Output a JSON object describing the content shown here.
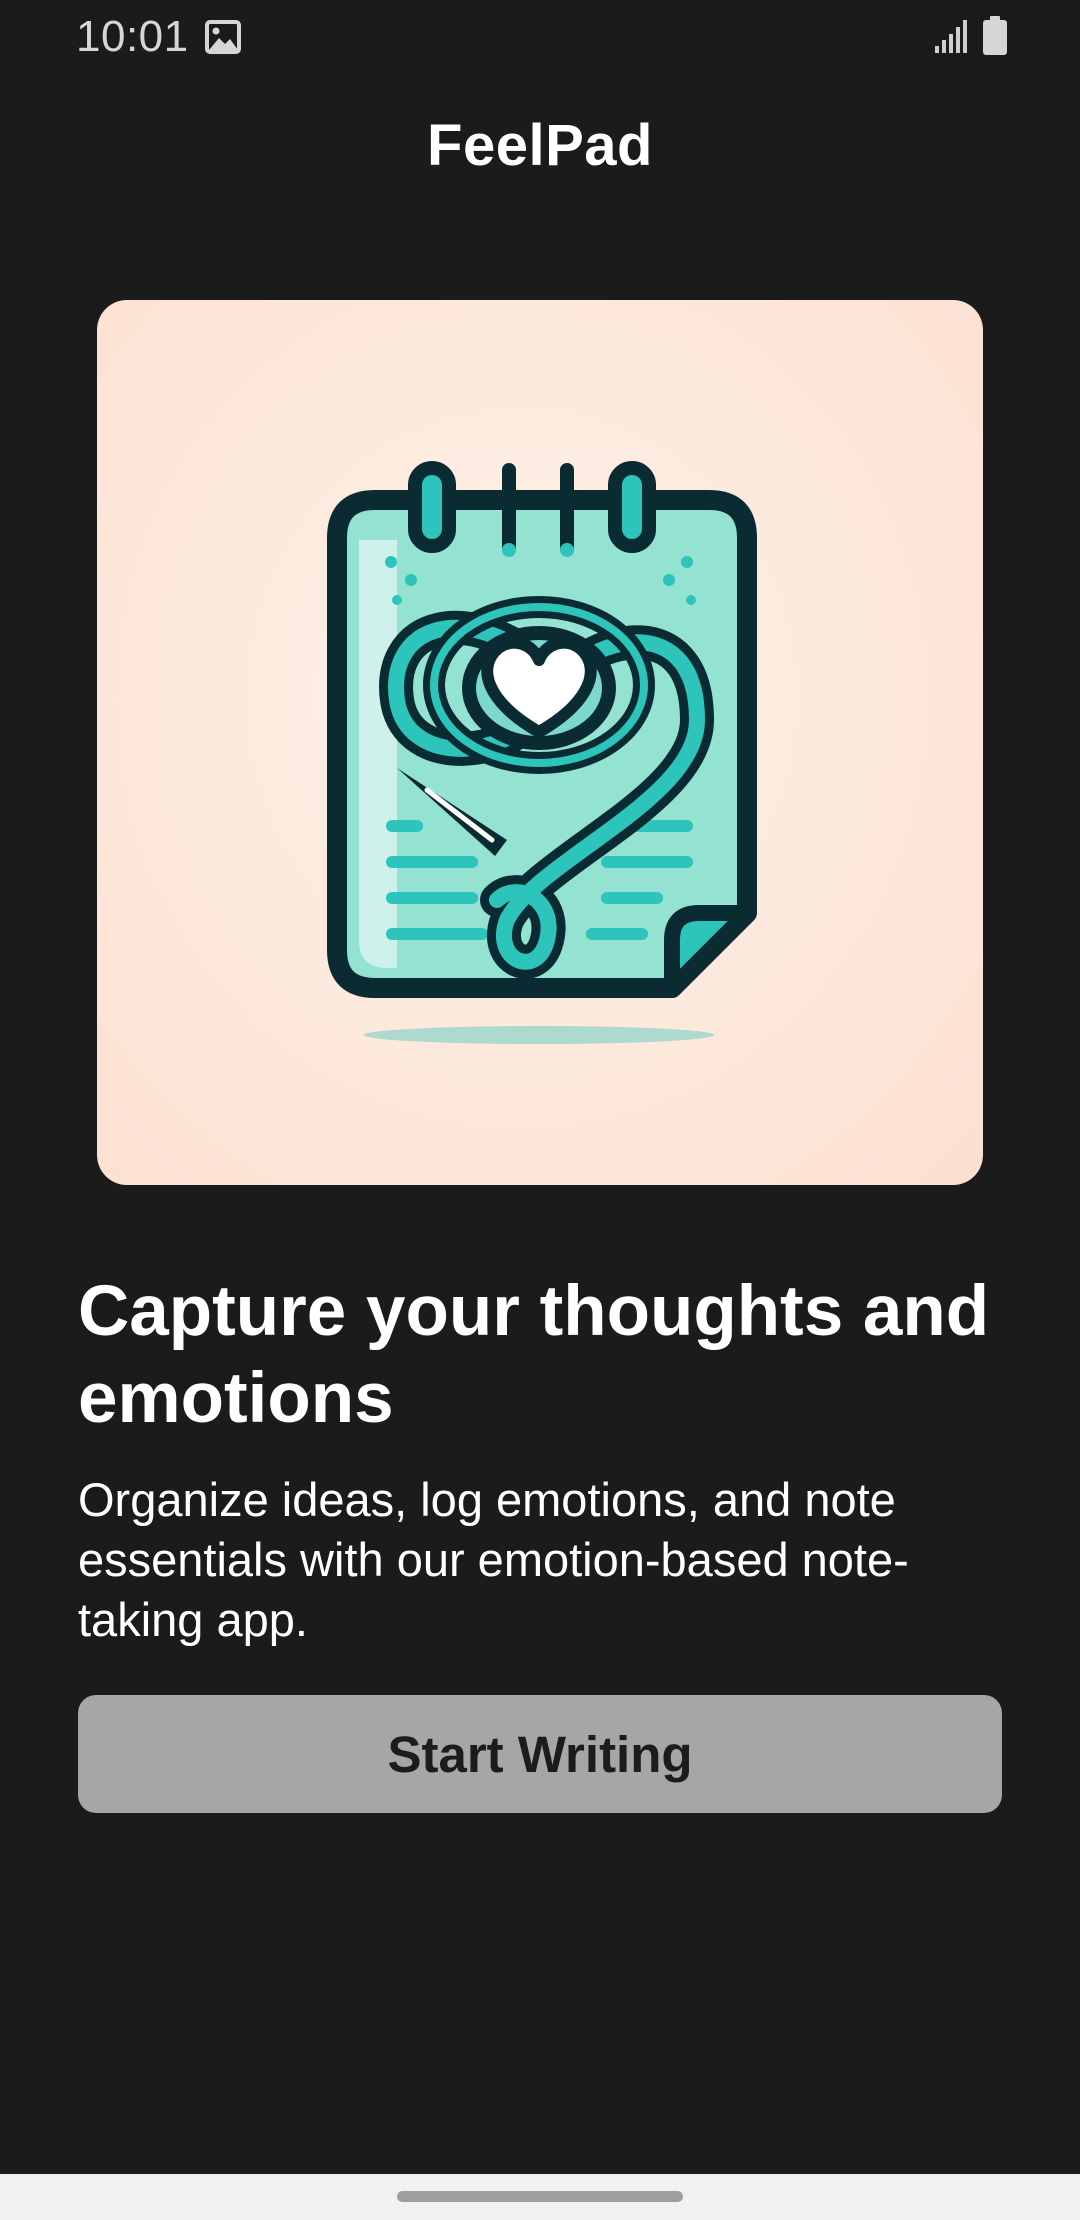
{
  "status_bar": {
    "time": "10:01",
    "icons": [
      "photo-icon",
      "signal-icon",
      "battery-icon"
    ]
  },
  "app": {
    "title": "FeelPad"
  },
  "hero": {
    "image": "notepad-heart-illustration",
    "colors": {
      "background": "#fde8dc",
      "teal": "#2cc4bb",
      "outline": "#0b2b33",
      "paper": "#8fe0cf"
    }
  },
  "onboarding": {
    "headline": "Capture your thoughts and emotions",
    "description": "Organize ideas, log emotions, and note essentials with our emotion-based note-taking app.",
    "cta_label": "Start Writing"
  },
  "theme": {
    "background": "#1b1b1b",
    "button_bg": "#a6a6a6",
    "button_text": "#1c1c1c"
  }
}
